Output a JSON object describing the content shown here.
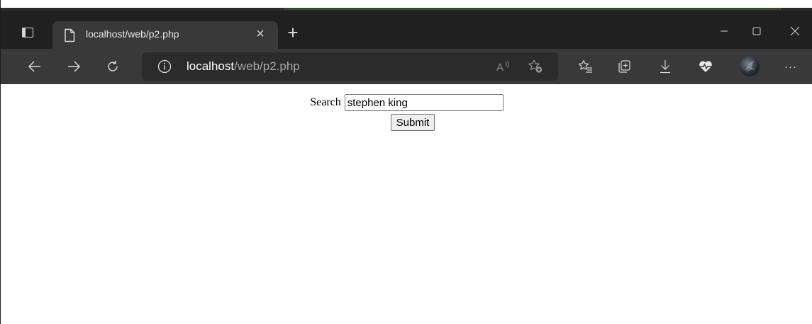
{
  "browser": {
    "tab": {
      "title": "localhost/web/p2.php",
      "close_glyph": "×"
    },
    "new_tab_glyph": "+",
    "address": {
      "host": "localhost",
      "path": "/web/p2.php",
      "read_aloud_glyph": "A̡⁾"
    },
    "more_glyph": "···",
    "colors": {
      "titlebar": "#202020",
      "toolbar": "#393939",
      "addressbar": "#2b2b2b",
      "tab_active": "#393939"
    },
    "icons": [
      "tab-actions-icon",
      "page-icon",
      "close-icon",
      "plus-icon",
      "minimize-icon",
      "maximize-icon",
      "window-close-icon",
      "back-icon",
      "forward-icon",
      "refresh-icon",
      "info-icon",
      "read-aloud-icon",
      "add-favorite-icon",
      "favorites-icon",
      "collections-icon",
      "downloads-icon",
      "health-icon",
      "avatar",
      "more-icon"
    ]
  },
  "page": {
    "search_label": "Search",
    "search_value": "stephen king",
    "submit_label": "Submit"
  }
}
